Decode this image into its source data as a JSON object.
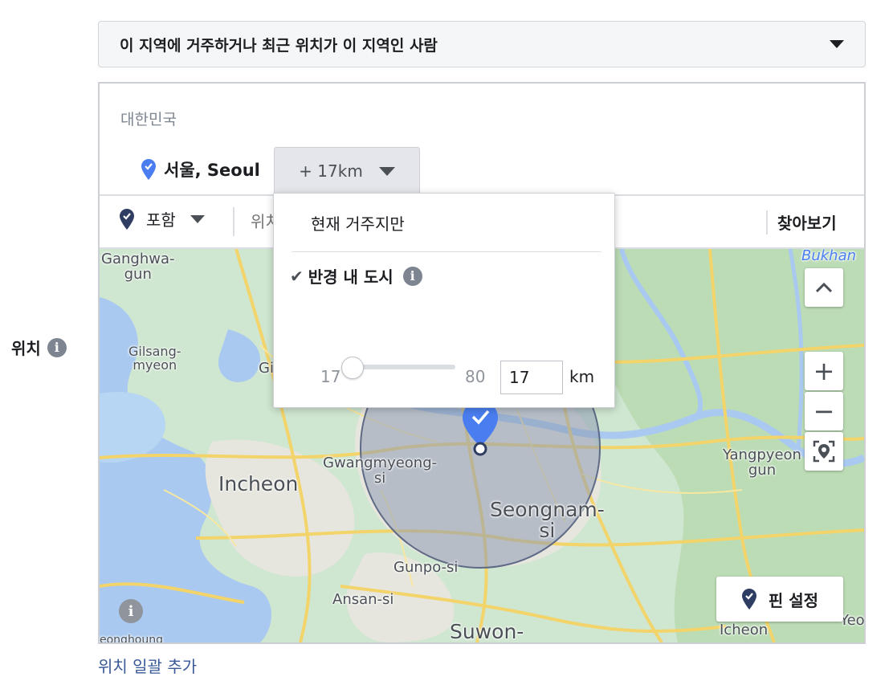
{
  "side": {
    "label": "위치"
  },
  "audience_select": {
    "value": "이 지역에 거주하거나 최근 위치가 이 지역인 사람"
  },
  "location": {
    "country": "대한민국",
    "city": "서울, Seoul",
    "radius_button": "+ 17km"
  },
  "toolbar": {
    "include_label": "포함",
    "search_placeholder": "위치",
    "browse_label": "찾아보기"
  },
  "radius_menu": {
    "option_current": "현재 거주지만",
    "option_radius": "반경 내 도시",
    "slider_min": "17",
    "slider_max": "80",
    "radius_value": "17",
    "unit": "km"
  },
  "map": {
    "labels": {
      "ganghwa": "Ganghwa-\ngun",
      "bukhan": "Bukhan",
      "gilsang": "Gilsang-\nmyeon",
      "gi": "Gi",
      "gwangmyeong": "Gwangmyeong-\nsi",
      "incheon": "Incheon",
      "seongnam": "Seongnam-\nsi",
      "yangpyeong": "Yangpyeon\ngun",
      "gunpo": "Gunpo-si",
      "ansan": "Ansan-si",
      "suwon": "Suwon-",
      "icheon": "Icheon",
      "yeo": "Yeo",
      "bottom_left": "eonghoung"
    },
    "controls": {
      "collapse": "^",
      "zoom_in": "+",
      "zoom_out": "−"
    },
    "pin_button": "핀 설정",
    "colors": {
      "pin": "#4a7ef0",
      "radius_fill": "#8e9bb5",
      "water": "#a9c9f0",
      "land": "#cfe6d0",
      "road": "#f3d46a"
    }
  },
  "footer": {
    "bulk_add": "위치 일괄 추가"
  }
}
